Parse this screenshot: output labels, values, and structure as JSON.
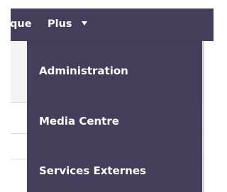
{
  "navbar": {
    "partial_item_label": "que",
    "plus_label": "Plus",
    "plus_icon": "caret-down-icon",
    "background": "#453d5a"
  },
  "dropdown": {
    "background": "#453d5a",
    "items": [
      {
        "label": "Administration"
      },
      {
        "label": "Media Centre"
      },
      {
        "label": "Services Externes"
      }
    ]
  }
}
